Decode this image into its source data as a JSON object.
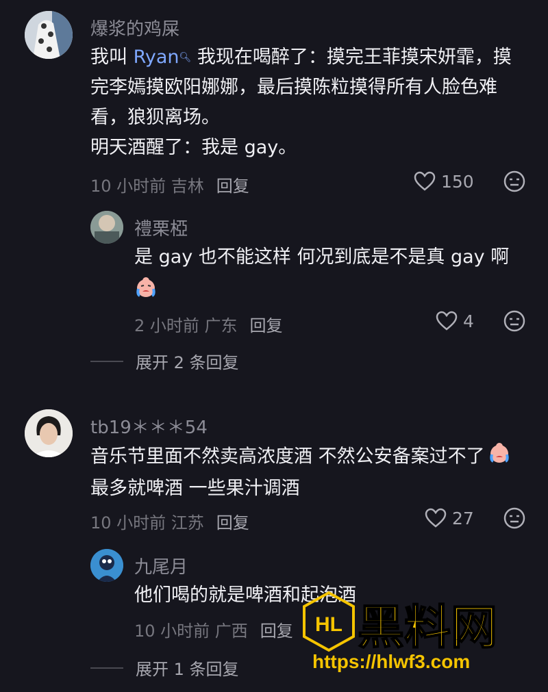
{
  "comments": [
    {
      "username": "爆浆的鸡屎",
      "text_prefix": "我叫 ",
      "mention": "Ryan",
      "text_line1_rest": " 我现在喝醉了：摸完王菲摸宋妍霏，摸",
      "text_line2": "完李嫣摸欧阳娜娜，最后摸陈粒摸得所有人脸色难",
      "text_line3": "看，狼狈离场。",
      "text_line4": "明天酒醒了：我是 gay。",
      "time": "10 小时前 吉林",
      "reply_label": "回复",
      "likes": "150"
    },
    {
      "username": "禮栗椏",
      "text": "是 gay 也不能这样 何况到底是不是真 gay 啊",
      "time": "2 小时前 广东",
      "reply_label": "回复",
      "likes": "4",
      "expand": "展开 2 条回复"
    },
    {
      "username": "tb19＊＊＊54",
      "text_line1": "音乐节里面不然卖高浓度酒 不然公安备案过不了",
      "text_line2": "最多就啤酒 一些果汁调酒",
      "time": "10 小时前 江苏",
      "reply_label": "回复",
      "likes": "27"
    },
    {
      "username": "九尾月",
      "text": "他们喝的就是啤酒和起泡酒",
      "time": "10 小时前 广西",
      "reply_label": "回复",
      "expand": "展开 1 条回复"
    }
  ],
  "watermark": {
    "logo_text": "HL",
    "title": "黑料网",
    "url": "https://hlwf3.com"
  },
  "colors": {
    "background": "#16161e",
    "mention": "#7fa8ff",
    "watermark": "#f5c400"
  }
}
